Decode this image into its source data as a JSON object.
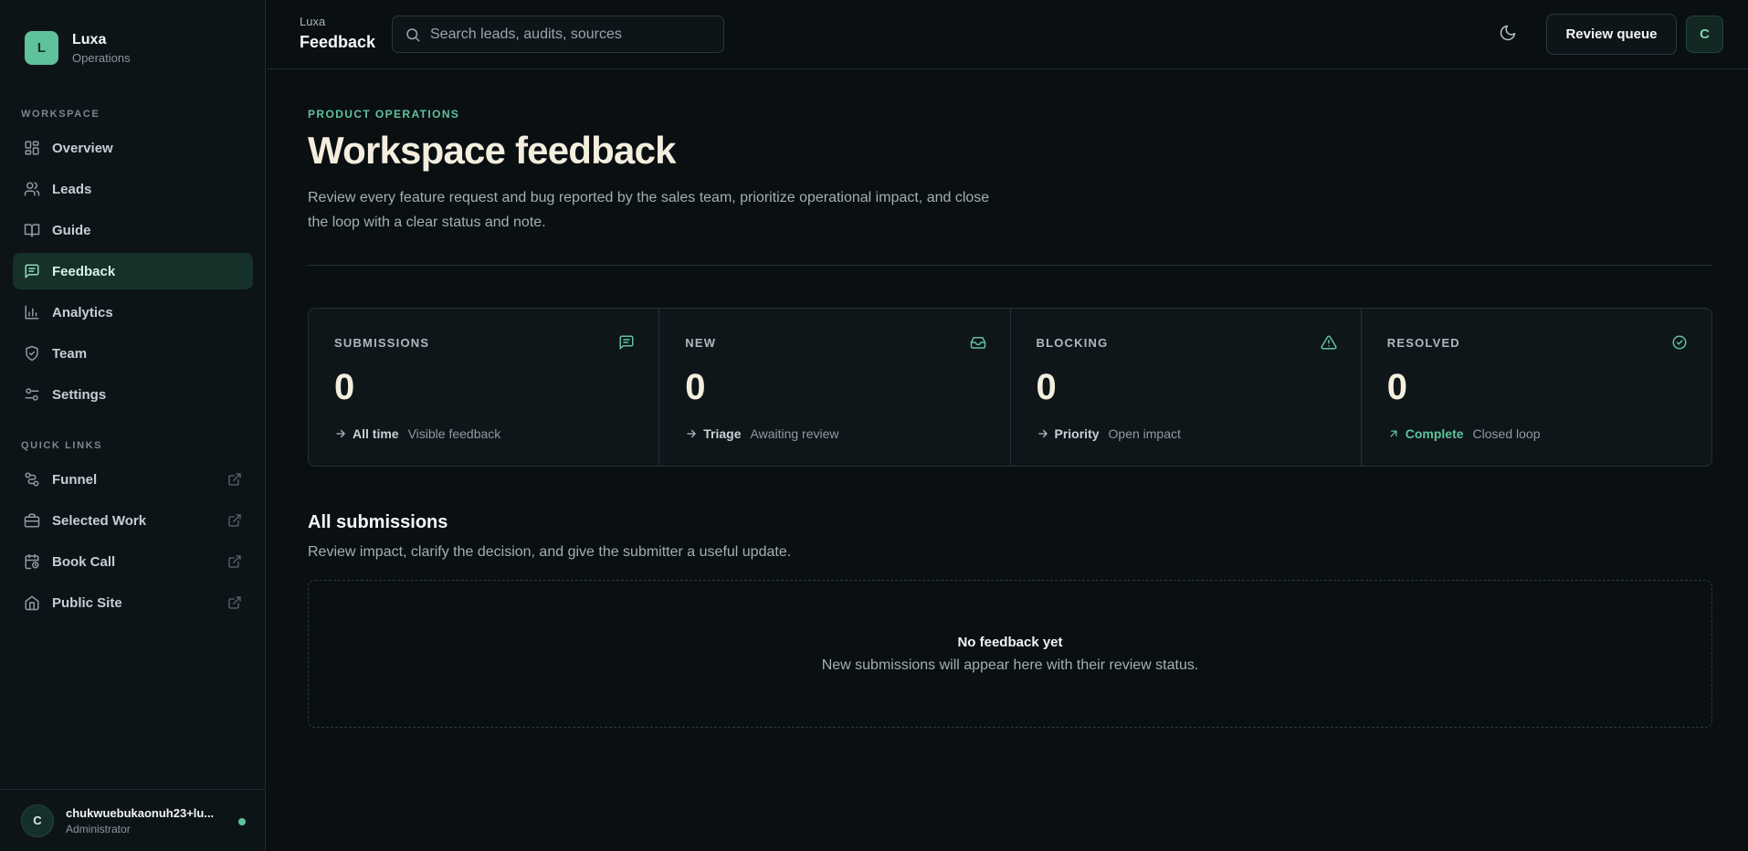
{
  "brand": {
    "logo_letter": "L",
    "name": "Luxa",
    "subtitle": "Operations"
  },
  "sidebar": {
    "workspace_label": "WORKSPACE",
    "items": [
      {
        "label": "Overview",
        "icon": "grid-icon",
        "active": false
      },
      {
        "label": "Leads",
        "icon": "users-icon",
        "active": false
      },
      {
        "label": "Guide",
        "icon": "book-icon",
        "active": false
      },
      {
        "label": "Feedback",
        "icon": "message-square-icon",
        "active": true
      },
      {
        "label": "Analytics",
        "icon": "bar-chart-icon",
        "active": false
      },
      {
        "label": "Team",
        "icon": "shield-icon",
        "active": false
      },
      {
        "label": "Settings",
        "icon": "sliders-icon",
        "active": false
      }
    ],
    "quick_links_label": "QUICK LINKS",
    "quick_links": [
      {
        "label": "Funnel",
        "icon": "route-icon"
      },
      {
        "label": "Selected Work",
        "icon": "briefcase-icon"
      },
      {
        "label": "Book Call",
        "icon": "calendar-clock-icon"
      },
      {
        "label": "Public Site",
        "icon": "home-icon"
      }
    ]
  },
  "user": {
    "avatar_letter": "C",
    "name": "chukwuebukaonuh23+lu...",
    "role": "Administrator"
  },
  "header": {
    "breadcrumb_top": "Luxa",
    "title": "Feedback",
    "search_placeholder": "Search leads, audits, sources",
    "review_button": "Review queue",
    "avatar_letter": "C"
  },
  "page": {
    "eyebrow": "PRODUCT OPERATIONS",
    "title": "Workspace feedback",
    "description": "Review every feature request and bug reported by the sales team, prioritize operational impact, and close the loop with a clear status and note."
  },
  "stats": [
    {
      "label": "SUBMISSIONS",
      "icon": "message-square-icon",
      "value": "0",
      "key": "All time",
      "muted": "Visible feedback",
      "arrow": "arrow-right-icon"
    },
    {
      "label": "NEW",
      "icon": "inbox-icon",
      "value": "0",
      "key": "Triage",
      "muted": "Awaiting review",
      "arrow": "arrow-right-icon"
    },
    {
      "label": "BLOCKING",
      "icon": "alert-triangle-icon",
      "value": "0",
      "key": "Priority",
      "muted": "Open impact",
      "arrow": "arrow-right-icon"
    },
    {
      "label": "RESOLVED",
      "icon": "check-circle-icon",
      "value": "0",
      "key": "Complete",
      "muted": "Closed loop",
      "arrow": "arrow-up-right-icon"
    }
  ],
  "submissions": {
    "title": "All submissions",
    "description": "Review impact, clarify the decision, and give the submitter a useful update.",
    "empty_title": "No feedback yet",
    "empty_description": "New submissions will appear here with their review status."
  },
  "colors": {
    "accent": "#5fc29b",
    "background": "#0a0f12",
    "active_nav": "#16302a"
  }
}
